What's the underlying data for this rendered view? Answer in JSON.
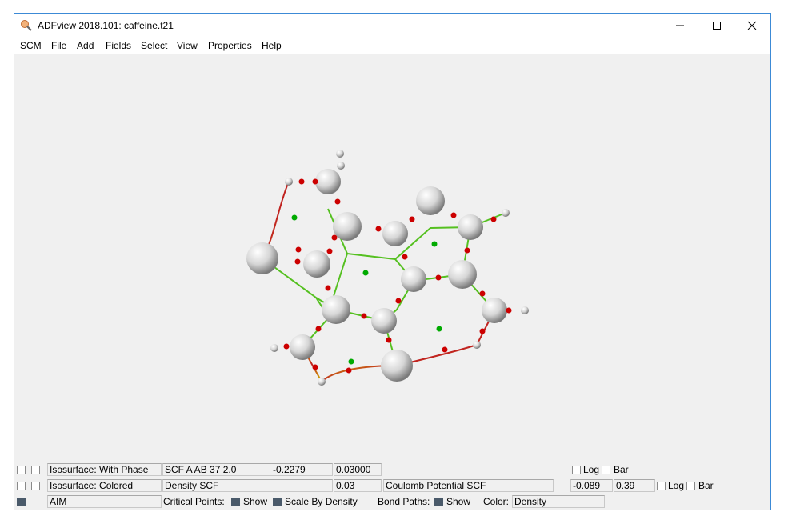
{
  "window": {
    "title": "ADFview 2018.101: caffeine.t21"
  },
  "menu": [
    {
      "label": "SCM",
      "underline": "S",
      "rest": "CM"
    },
    {
      "label": "File",
      "underline": "F",
      "rest": "ile"
    },
    {
      "label": "Add",
      "underline": "A",
      "rest": "dd"
    },
    {
      "label": "Fields",
      "underline": "F",
      "rest": "ields"
    },
    {
      "label": "Select",
      "underline": "S",
      "rest": "elect"
    },
    {
      "label": "View",
      "underline": "V",
      "rest": "iew"
    },
    {
      "label": "Properties",
      "underline": "P",
      "rest": "roperties"
    },
    {
      "label": "Help",
      "underline": "H",
      "rest": "elp"
    }
  ],
  "row1": {
    "name": "Isosurface: With Phase",
    "field": "SCF A AB 37 2.0",
    "value": "-0.2279",
    "iso": "0.03000",
    "log_label": "Log",
    "bar_label": "Bar"
  },
  "row2": {
    "name": "Isosurface: Colored",
    "field": "Density SCF",
    "iso": "0.03",
    "color_field": "Coulomb Potential SCF",
    "min": "-0.089",
    "max": "0.39",
    "log_label": "Log",
    "bar_label": "Bar"
  },
  "row3": {
    "name": "AIM",
    "critical_points_label": "Critical Points:",
    "show_label": "Show",
    "scale_label": "Scale By Density",
    "bond_paths_label": "Bond Paths:",
    "show2_label": "Show",
    "color_label": "Color:",
    "color_value": "Density"
  },
  "colors": {
    "atom": "#e8e8e8",
    "critical_point_bond": "#cc0000",
    "critical_point_ring": "#00aa00",
    "selection_blue": "#3c8ad6"
  }
}
